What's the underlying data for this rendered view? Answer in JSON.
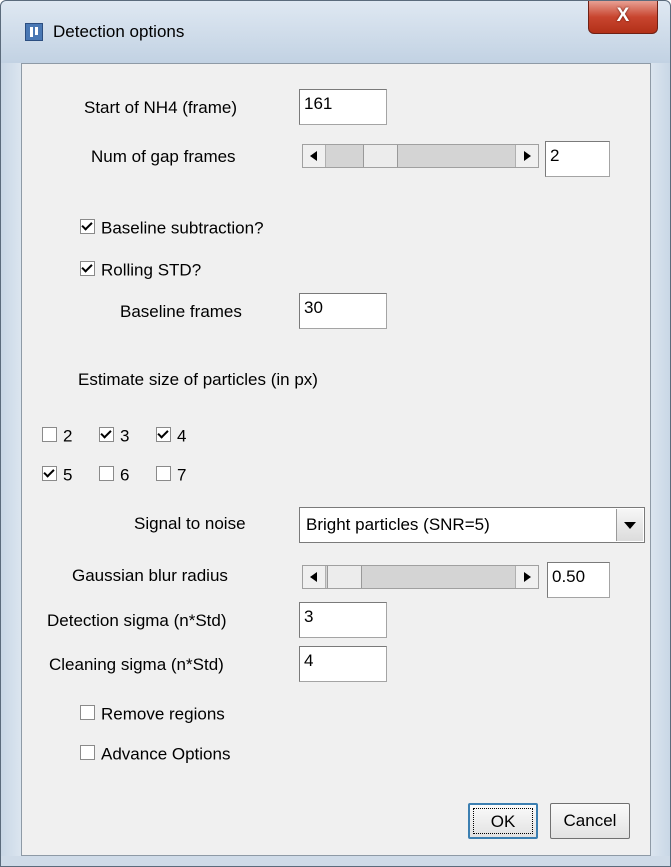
{
  "window": {
    "title": "Detection options",
    "close_label": "X"
  },
  "fields": {
    "start_nh4": {
      "label": "Start of NH4 (frame)",
      "value": "161"
    },
    "gap_frames": {
      "label": "Num of gap frames",
      "value": "2",
      "slider_fraction": 0.29
    },
    "baseline_frames": {
      "label": "Baseline frames",
      "value": "30"
    },
    "gaussian_blur": {
      "label": "Gaussian blur radius",
      "value": "0.50",
      "slider_fraction": 0.13
    },
    "detection_sigma": {
      "label": "Detection sigma (n*Std)",
      "value": "3"
    },
    "cleaning_sigma": {
      "label": "Cleaning sigma (n*Std)",
      "value": "4"
    }
  },
  "checkboxes": {
    "baseline_subtraction": {
      "label": "Baseline subtraction?",
      "checked": true
    },
    "rolling_std": {
      "label": "Rolling STD?",
      "checked": true
    },
    "remove_regions": {
      "label": "Remove regions",
      "checked": false
    },
    "advance_options": {
      "label": "Advance Options",
      "checked": false
    }
  },
  "particle_size": {
    "label": "Estimate size of particles (in px)",
    "options": [
      {
        "label": "2",
        "checked": false
      },
      {
        "label": "3",
        "checked": true
      },
      {
        "label": "4",
        "checked": true
      },
      {
        "label": "5",
        "checked": true
      },
      {
        "label": "6",
        "checked": false
      },
      {
        "label": "7",
        "checked": false
      }
    ]
  },
  "signal_to_noise": {
    "label": "Signal to noise",
    "selected": "Bright particles (SNR=5)"
  },
  "buttons": {
    "ok": "OK",
    "cancel": "Cancel"
  },
  "colors": {
    "title_bar": "#c5d3e2",
    "close_button": "#c8452f",
    "panel": "#f0f0f0",
    "default_button_border": "#3c7fb1"
  }
}
